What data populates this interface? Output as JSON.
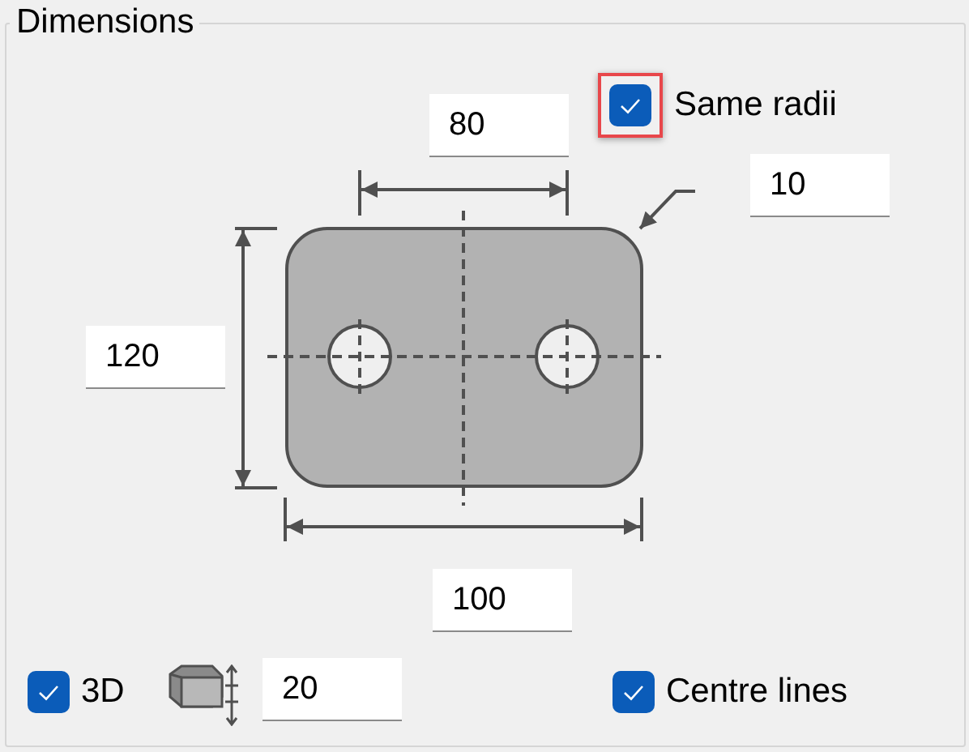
{
  "group": {
    "title": "Dimensions"
  },
  "same_radii": {
    "label": "Same radii",
    "checked": true,
    "highlighted": true
  },
  "fields": [
    {
      "kind": "spacing",
      "value": "80"
    },
    {
      "kind": "radius",
      "value": "10"
    },
    {
      "kind": "height",
      "value": "120"
    },
    {
      "kind": "width",
      "value": "100"
    },
    {
      "kind": "thickness",
      "value": "20"
    }
  ],
  "options": [
    {
      "kind": "three_d",
      "label": "3D",
      "checked": true
    },
    {
      "kind": "centre_lines",
      "label": "Centre lines",
      "checked": true
    }
  ]
}
